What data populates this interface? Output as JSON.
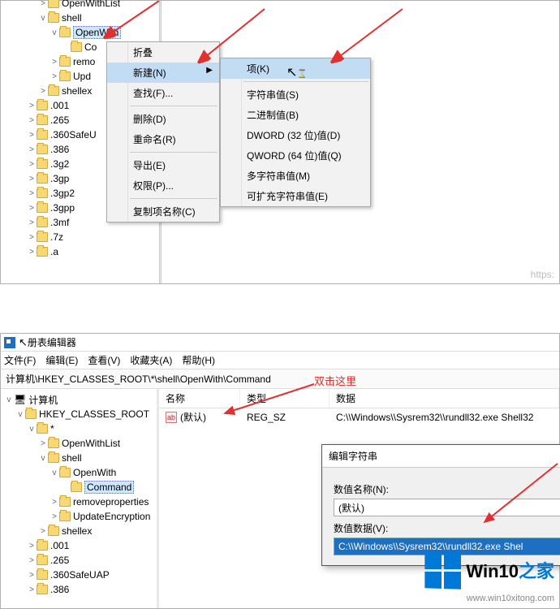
{
  "top": {
    "tree": [
      {
        "indent": 3,
        "chev": ">",
        "label": "OpenWithList"
      },
      {
        "indent": 3,
        "chev": "v",
        "label": "shell"
      },
      {
        "indent": 4,
        "chev": "v",
        "label": "OpenWith",
        "sel": true
      },
      {
        "indent": 5,
        "chev": "",
        "label": "Co"
      },
      {
        "indent": 4,
        "chev": ">",
        "label": "remo"
      },
      {
        "indent": 4,
        "chev": ">",
        "label": "Upd"
      },
      {
        "indent": 3,
        "chev": ">",
        "label": "shellex"
      },
      {
        "indent": 2,
        "chev": ">",
        "label": ".001"
      },
      {
        "indent": 2,
        "chev": ">",
        "label": ".265"
      },
      {
        "indent": 2,
        "chev": ">",
        "label": ".360SafeU"
      },
      {
        "indent": 2,
        "chev": ">",
        "label": ".386"
      },
      {
        "indent": 2,
        "chev": ">",
        "label": ".3g2"
      },
      {
        "indent": 2,
        "chev": ">",
        "label": ".3gp"
      },
      {
        "indent": 2,
        "chev": ">",
        "label": ".3gp2"
      },
      {
        "indent": 2,
        "chev": ">",
        "label": ".3gpp"
      },
      {
        "indent": 2,
        "chev": ">",
        "label": ".3mf"
      },
      {
        "indent": 2,
        "chev": ">",
        "label": ".7z"
      },
      {
        "indent": 2,
        "chev": ">",
        "label": ".a"
      }
    ],
    "menu1": {
      "items": [
        {
          "label": "折叠"
        },
        {
          "label": "新建(N)",
          "hl": true,
          "sub": true
        },
        {
          "label": "查找(F)..."
        },
        {
          "sep": true
        },
        {
          "label": "删除(D)"
        },
        {
          "label": "重命名(R)"
        },
        {
          "sep": true
        },
        {
          "label": "导出(E)"
        },
        {
          "label": "权限(P)..."
        },
        {
          "sep": true
        },
        {
          "label": "复制项名称(C)"
        }
      ]
    },
    "menu2": {
      "items": [
        {
          "label": "项(K)",
          "hl": true
        },
        {
          "sep": true
        },
        {
          "label": "字符串值(S)"
        },
        {
          "label": "二进制值(B)"
        },
        {
          "label": "DWORD (32 位)值(D)"
        },
        {
          "label": "QWORD (64 位)值(Q)"
        },
        {
          "label": "多字符串值(M)"
        },
        {
          "label": "可扩充字符串值(E)"
        }
      ]
    },
    "https": "https:"
  },
  "bottom": {
    "title": "册表编辑器",
    "menus": [
      "文件(F)",
      "编辑(E)",
      "查看(V)",
      "收藏夹(A)",
      "帮助(H)"
    ],
    "path": "计算机\\HKEY_CLASSES_ROOT\\*\\shell\\OpenWith\\Command",
    "headers": {
      "name": "名称",
      "type": "类型",
      "data": "数据"
    },
    "row": {
      "name": "(默认)",
      "type": "REG_SZ",
      "data": "C:\\\\Windows\\\\Sysrem32\\\\rundll32.exe Shell32"
    },
    "tree": [
      {
        "indent": 0,
        "chev": "v",
        "label": "计算机",
        "pc": true
      },
      {
        "indent": 1,
        "chev": "v",
        "label": "HKEY_CLASSES_ROOT"
      },
      {
        "indent": 2,
        "chev": "v",
        "label": "*"
      },
      {
        "indent": 3,
        "chev": ">",
        "label": "OpenWithList"
      },
      {
        "indent": 3,
        "chev": "v",
        "label": "shell"
      },
      {
        "indent": 4,
        "chev": "v",
        "label": "OpenWith"
      },
      {
        "indent": 5,
        "chev": "",
        "label": "Command",
        "sel": true
      },
      {
        "indent": 4,
        "chev": ">",
        "label": "removeproperties"
      },
      {
        "indent": 4,
        "chev": ">",
        "label": "UpdateEncryption"
      },
      {
        "indent": 3,
        "chev": ">",
        "label": "shellex"
      },
      {
        "indent": 2,
        "chev": ">",
        "label": ".001"
      },
      {
        "indent": 2,
        "chev": ">",
        "label": ".265"
      },
      {
        "indent": 2,
        "chev": ">",
        "label": ".360SafeUAP"
      },
      {
        "indent": 2,
        "chev": ">",
        "label": ".386"
      }
    ],
    "dialog": {
      "title": "编辑字符串",
      "name_label": "数值名称(N):",
      "name_value": "(默认)",
      "data_label": "数值数据(V):",
      "data_value": "C:\\\\Windows\\\\Sysrem32\\\\rundll32.exe Shel"
    },
    "annotation": "双击这里",
    "logo_text_a": "Win10",
    "logo_text_b": "之家",
    "url": "www.win10xitong.com"
  }
}
